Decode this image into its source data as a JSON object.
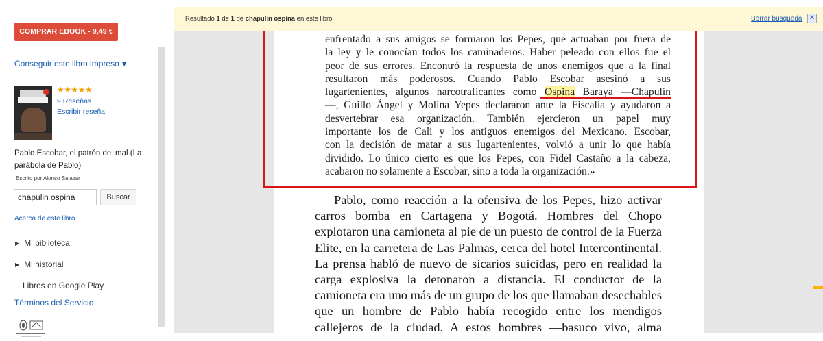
{
  "sidebar": {
    "buy_button": "COMPRAR EBOOK - 9,49 €",
    "print_link": "Conseguir este libro impreso",
    "print_caret": "▼",
    "rating_stars": "★★★★★",
    "rating_value": 4.5,
    "reviews_link": "9 Reseñas",
    "write_review": "Escribir reseña",
    "book_title": "Pablo Escobar, el patrón del mal (La parábola de Pablo)",
    "author": "Escrito por Alonso Salazar",
    "search_value": "chapulin ospina",
    "search_button": "Buscar",
    "about_link": "Acerca de este libro",
    "nav": [
      {
        "label": "Mi biblioteca",
        "icon": "triangle-right-icon"
      },
      {
        "label": "Mi historial",
        "icon": "triangle-right-icon"
      },
      {
        "label": "Libros en Google Play"
      }
    ],
    "terms": "Términos del Servicio"
  },
  "result_bar": {
    "prefix": "Resultado ",
    "current": "1",
    "middle": " de ",
    "total": "1",
    "middle2": " de ",
    "query": "chapulin ospina",
    "suffix": " en este libro",
    "clear": "Borrar búsqueda",
    "close": "✕"
  },
  "quote_lines": [
    "enfrentado a sus amigos se formaron los Pepes, que actuaban por fuera de",
    "la ley y le conocían todos los caminaderos. Haber peleado con ellos fue el",
    "peor de sus errores. Encontró la respuesta de unos enemigos que a la final",
    "resultaron más poderosos. Cuando Pablo Escobar asesinó a sus",
    {
      "before": "lugartenientes, algunos narcotraficantes como ",
      "highlight": "Ospina",
      "after": " Baraya —Chapulín"
    },
    "—, Guillo Ángel y Molina Yepes declararon ante la Fiscalía y ayudaron a",
    "desvertebrar esa organización. También ejercieron un papel muy",
    "importante los de Cali y los antiguos enemigos del Mexicano. Escobar,",
    "con la decisión de matar a sus lugartenientes, volvió a unir lo que había",
    "dividido. Lo único cierto es que los Pepes, con Fidel Castaño a la cabeza,",
    "acabaron no solamente a Escobar, sino a toda la organización.»"
  ],
  "main_lines": [
    "Pablo, como reacción a la ofensiva de los Pepes, hizo activar",
    "carros bomba en Cartagena y Bogotá. Hombres del Chopo",
    "explotaron una camioneta al pie de un puesto de control de la Fuerza",
    "Elite, en la carretera de Las Palmas, cerca del hotel Intercontinental.",
    "La prensa habló de nuevo de sicarios suicidas, pero en realidad la",
    "carga explosiva la detonaron a distancia. El conductor de la",
    "camioneta era uno más de un grupo de los que llamaban desechables",
    "que un hombre de Pablo había recogido entre los mendigos",
    "callejeros de la ciudad. A estos hombres —basuco vivo, alma"
  ],
  "colors": {
    "buy_button": "#dd4b39",
    "link": "#1a5fb4",
    "highlight": "#fff3a0",
    "annotation": "#d9151c",
    "result_bar": "#fff8d6"
  }
}
